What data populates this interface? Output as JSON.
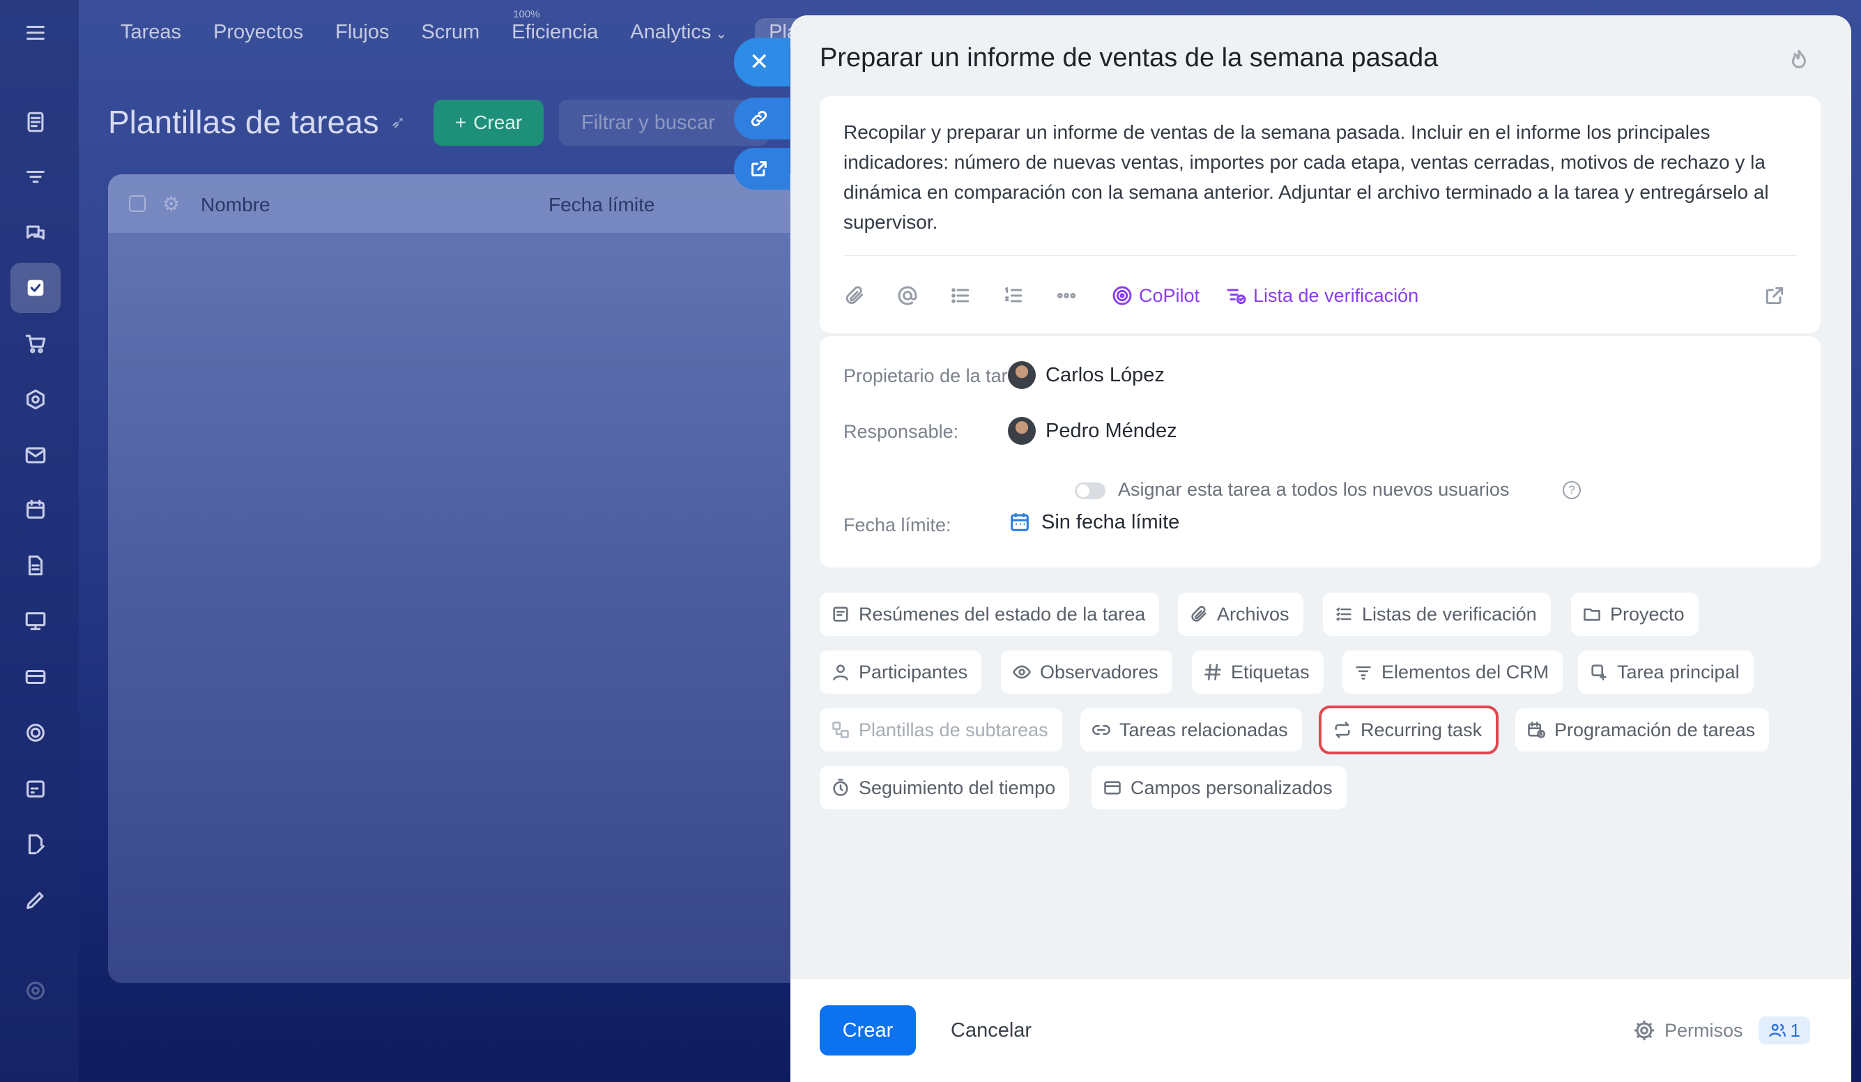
{
  "topnav": {
    "items": [
      "Tareas",
      "Proyectos",
      "Flujos",
      "Scrum",
      "Eficiencia",
      "Analytics",
      "Pla"
    ],
    "efficiency_badge": "100%"
  },
  "page": {
    "title": "Plantillas de tareas",
    "create_label": "Crear",
    "filter_placeholder": "Filtrar y buscar",
    "table_headers": [
      "Nombre",
      "Fecha límite"
    ]
  },
  "slider": {
    "title": "Preparar un informe de ventas de la semana pasada",
    "description": "Recopilar y preparar un informe de ventas de la semana pasada. Incluir en el informe los principales indicadores: número de nuevas ventas, importes por cada etapa, ventas cerradas, motivos de rechazo y la dinámica en comparación con la semana anterior. Adjuntar el archivo terminado a la tarea y entregárselo al supervisor.",
    "toolbar": {
      "copilot_label": "CoPilot",
      "checklist_label": "Lista de verificación"
    },
    "props": {
      "owner_label": "Propietario de la tarea:",
      "owner_name": "Carlos López",
      "responsible_label": "Responsable:",
      "responsible_name": "Pedro Méndez",
      "assign_all_label": "Asignar esta tarea a todos los nuevos usuarios",
      "deadline_label": "Fecha límite:",
      "deadline_value": "Sin fecha límite"
    },
    "chips": [
      {
        "label": "Resúmenes del estado de la tarea",
        "icon": "summary-icon"
      },
      {
        "label": "Archivos",
        "icon": "paperclip-icon"
      },
      {
        "label": "Listas de verificación",
        "icon": "checklist-icon"
      },
      {
        "label": "Proyecto",
        "icon": "folder-icon"
      },
      {
        "label": "Participantes",
        "icon": "user-icon"
      },
      {
        "label": "Observadores",
        "icon": "eye-icon"
      },
      {
        "label": "Etiquetas",
        "icon": "hash-icon"
      },
      {
        "label": "Elementos del CRM",
        "icon": "crm-icon"
      },
      {
        "label": "Tarea principal",
        "icon": "parent-task-icon"
      },
      {
        "label": "Plantillas de subtareas",
        "icon": "subtask-template-icon"
      },
      {
        "label": "Tareas relacionadas",
        "icon": "link-icon"
      },
      {
        "label": "Recurring task",
        "icon": "repeat-icon"
      },
      {
        "label": "Programación de tareas",
        "icon": "schedule-icon"
      },
      {
        "label": "Seguimiento del tiempo",
        "icon": "timer-icon"
      },
      {
        "label": "Campos personalizados",
        "icon": "custom-fields-icon"
      }
    ],
    "footer": {
      "create_label": "Crear",
      "cancel_label": "Cancelar",
      "permissions_label": "Permisos",
      "permissions_count": "1"
    }
  },
  "colors": {
    "accent": "#0c72f0",
    "copilot": "#8a3cf0",
    "highlight": "#e0474f",
    "create_green": "#1e8f78"
  }
}
